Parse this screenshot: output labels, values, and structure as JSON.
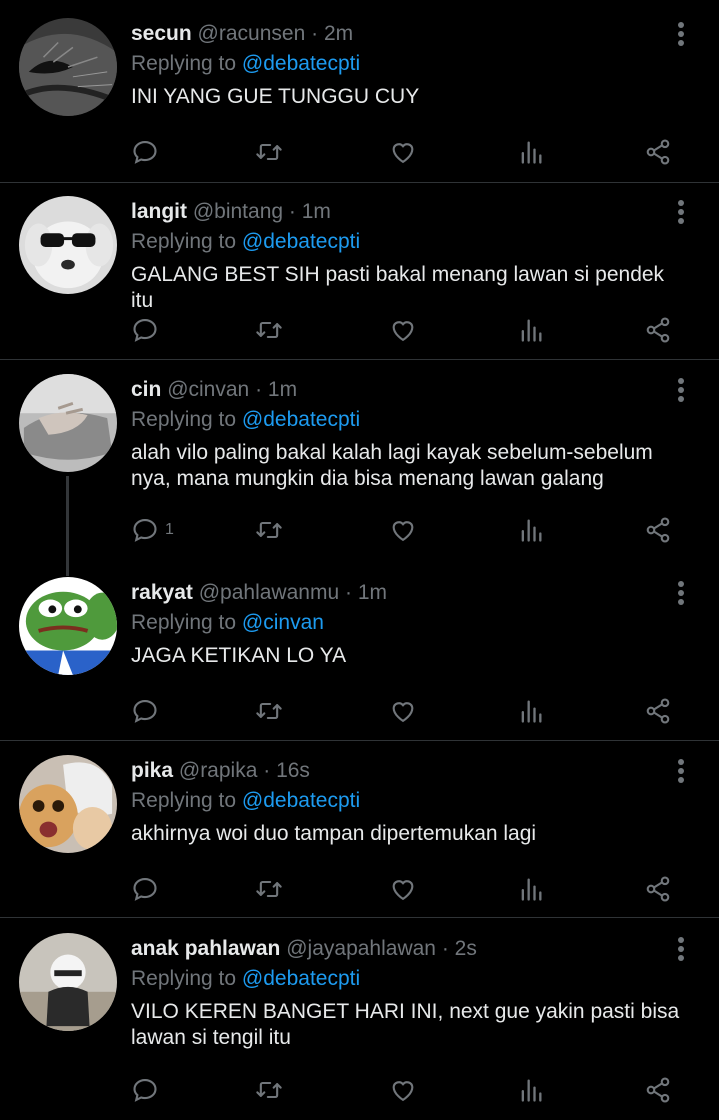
{
  "tweets": [
    {
      "name": "secun",
      "handle": "@racunsen",
      "time": "2m",
      "replying_label": "Replying to",
      "replying_to": "@debatecpti",
      "text": "INI YANG GUE TUNGGU CUY",
      "avatar": "dark-eye-avatar",
      "reply_count": ""
    },
    {
      "name": "langit",
      "handle": "@bintang",
      "time": "1m",
      "replying_label": "Replying to",
      "replying_to": "@debatecpti",
      "text": "GALANG BEST SIH pasti bakal menang lawan si pendek itu",
      "avatar": "dog-with-sunglasses-avatar",
      "reply_count": ""
    },
    {
      "name": "cin",
      "handle": "@cinvan",
      "time": "1m",
      "replying_label": "Replying to",
      "replying_to": "@debatecpti",
      "text": "alah vilo paling bakal kalah lagi kayak sebelum-sebelum nya, mana mungkin dia bisa menang lawan galang",
      "avatar": "hand-photo-avatar",
      "reply_count": "1"
    },
    {
      "name": "rakyat",
      "handle": "@pahlawanmu",
      "time": "1m",
      "replying_label": "Replying to",
      "replying_to": "@cinvan",
      "text": "JAGA KETIKAN LO YA",
      "avatar": "pepe-frog-avatar",
      "reply_count": ""
    },
    {
      "name": "pika",
      "handle": "@rapika",
      "time": "16s",
      "replying_label": "Replying to",
      "replying_to": "@debatecpti",
      "text": "akhirnya woi duo tampan dipertemukan lagi",
      "avatar": "cat-and-cap-avatar",
      "reply_count": ""
    },
    {
      "name": "anak pahlawan",
      "handle": "@jayapahlawan",
      "time": "2s",
      "replying_label": "Replying to",
      "replying_to": "@debatecpti",
      "text": "VILO KEREN BANGET HARI INI, next gue yakin pasti bisa lawan si tengil itu",
      "avatar": "helmet-figure-avatar",
      "reply_count": ""
    }
  ],
  "separator": "·",
  "icons": {
    "reply": "reply-icon",
    "retweet": "retweet-icon",
    "like": "like-icon",
    "views": "views-icon",
    "share": "share-icon",
    "more": "more-options-icon"
  },
  "colors": {
    "background": "#000000",
    "text": "#e7e9ea",
    "muted": "#71767b",
    "mention": "#1d9bf0"
  }
}
